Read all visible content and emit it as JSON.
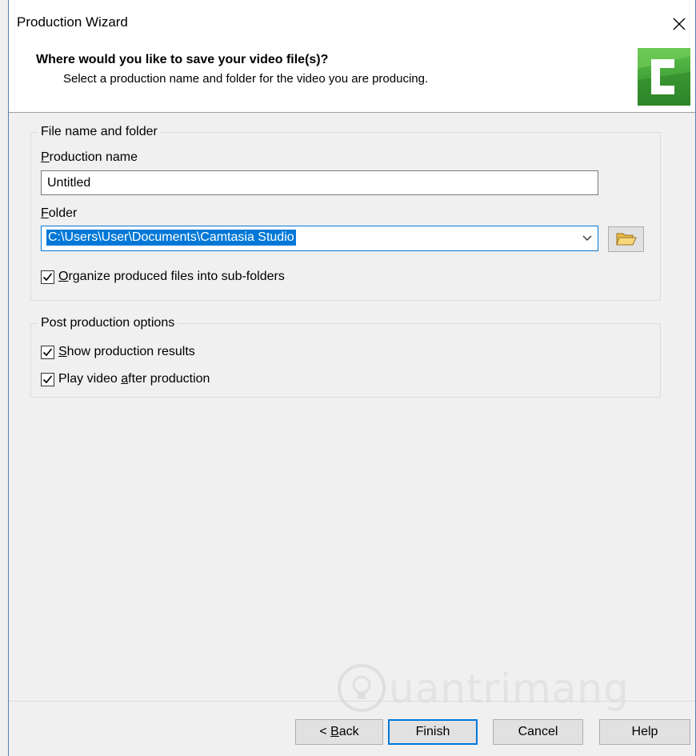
{
  "window": {
    "title": "Production Wizard"
  },
  "header": {
    "heading": "Where would you like to save your video file(s)?",
    "subheading": "Select a production name and folder for the video you are producing."
  },
  "file_group": {
    "legend": "File name and folder",
    "production_name_label_underlined": "P",
    "production_name_label_rest": "roduction name",
    "production_name_value": "Untitled",
    "folder_label_underlined": "F",
    "folder_label_rest": "older",
    "folder_value": "C:\\Users\\User\\Documents\\Camtasia Studio",
    "organize_checked": true,
    "organize_label_underlined": "O",
    "organize_label_rest": "rganize produced files into sub-folders"
  },
  "post_group": {
    "legend": "Post production options",
    "show_results_checked": true,
    "show_results_underlined": "S",
    "show_results_rest": "how production results",
    "play_video_checked": true,
    "play_video_pre": "Play video ",
    "play_video_underlined": "a",
    "play_video_rest": "fter production"
  },
  "buttons": {
    "back_pre": "< ",
    "back_underlined": "B",
    "back_rest": "ack",
    "finish": "Finish",
    "cancel": "Cancel",
    "help": "Help"
  },
  "watermark": {
    "text": "uantrimang"
  },
  "colors": {
    "accent": "#0078d7",
    "logo_green": "#3aa635"
  }
}
